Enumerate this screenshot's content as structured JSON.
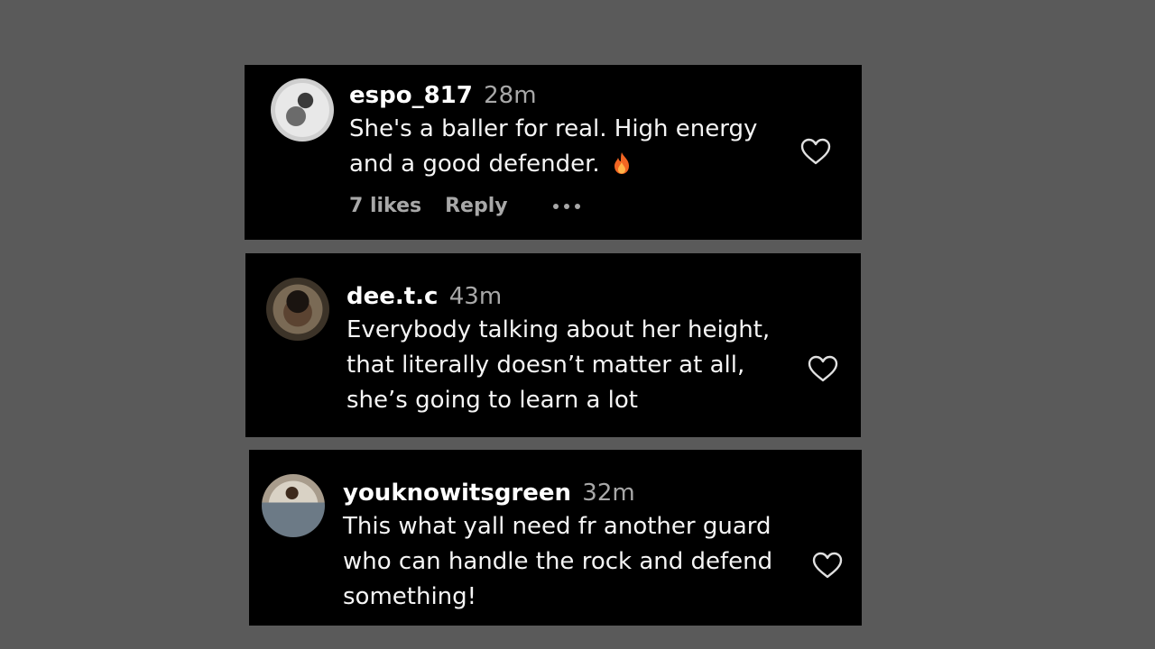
{
  "colors": {
    "page_background": "#5a5a5a",
    "card_background": "#000000",
    "username": "#ffffff",
    "secondary_text": "#a8a8a8",
    "fire": "#f26522"
  },
  "comments": [
    {
      "username": "espo_817",
      "time": "28m",
      "text": "She's a baller for real. High energy and a good defender.",
      "emoji_icon": "fire-icon",
      "likes": "7 likes",
      "reply": "Reply",
      "more_icon": "more-options-icon",
      "like_icon": "heart-outline-icon"
    },
    {
      "username": "dee.t.c",
      "time": "43m",
      "text": "Everybody talking about her height, that literally doesn’t matter at all, she’s going to learn a lot",
      "like_icon": "heart-outline-icon"
    },
    {
      "username": "youknowitsgreen",
      "time": "32m",
      "text": "This what yall need fr another guard who can handle the rock and defend something!",
      "like_icon": "heart-outline-icon"
    }
  ]
}
